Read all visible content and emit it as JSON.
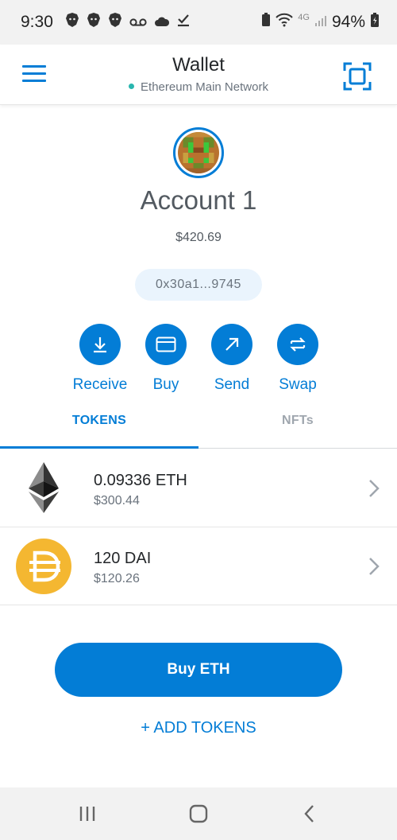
{
  "status_bar": {
    "time": "9:30",
    "network_label": "4G",
    "battery": "94%"
  },
  "header": {
    "title": "Wallet",
    "network": "Ethereum Main Network",
    "menu_icon": "hamburger-menu-icon",
    "scan_icon": "qr-scan-icon"
  },
  "account": {
    "name": "Account 1",
    "balance": "$420.69",
    "address": "0x30a1...9745"
  },
  "actions": [
    {
      "label": "Receive",
      "icon": "receive-icon"
    },
    {
      "label": "Buy",
      "icon": "card-icon"
    },
    {
      "label": "Send",
      "icon": "send-arrow-icon"
    },
    {
      "label": "Swap",
      "icon": "swap-icon"
    }
  ],
  "tabs": [
    {
      "label": "TOKENS",
      "active": true
    },
    {
      "label": "NFTs",
      "active": false
    }
  ],
  "tokens": [
    {
      "amount": "0.09336 ETH",
      "fiat": "$300.44",
      "icon": "ethereum-icon"
    },
    {
      "amount": "120 DAI",
      "fiat": "$120.26",
      "icon": "dai-icon"
    }
  ],
  "buy_button": "Buy ETH",
  "add_tokens": "+ ADD TOKENS",
  "colors": {
    "accent": "#037dd6",
    "dai_yellow": "#f4b731",
    "network_dot": "#29b6af"
  }
}
